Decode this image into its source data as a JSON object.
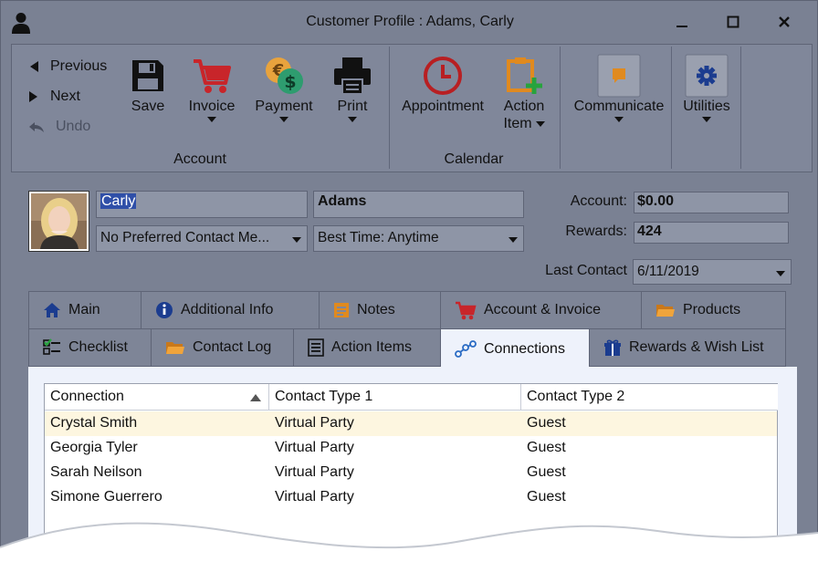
{
  "window": {
    "title": "Customer Profile : Adams, Carly"
  },
  "ribbon": {
    "nav": {
      "previous": "Previous",
      "next": "Next",
      "undo": "Undo"
    },
    "buttons": {
      "save": "Save",
      "invoice": "Invoice",
      "payment": "Payment",
      "print": "Print",
      "appointment": "Appointment",
      "action_item_1": "Action",
      "action_item_2": "Item",
      "communicate": "Communicate",
      "utilities": "Utilities"
    },
    "groups": {
      "account": "Account",
      "calendar": "Calendar"
    }
  },
  "profile": {
    "first_name": "Carly",
    "last_name": "Adams",
    "preferred_contact": "No Preferred Contact Me...",
    "best_time": "Best Time: Anytime",
    "account_label": "Account:",
    "account_value": "$0.00",
    "rewards_label": "Rewards:",
    "rewards_value": "424",
    "last_contact_label": "Last Contact",
    "last_contact_value": "6/11/2019"
  },
  "tabs": {
    "main": "Main",
    "additional_info": "Additional Info",
    "notes": "Notes",
    "account_invoice": "Account & Invoice",
    "products": "Products",
    "checklist": "Checklist",
    "contact_log": "Contact Log",
    "action_items": "Action Items",
    "connections": "Connections",
    "rewards_wish_list": "Rewards & Wish List"
  },
  "grid": {
    "columns": [
      "Connection",
      "Contact Type 1",
      "Contact Type 2"
    ],
    "rows": [
      [
        "Crystal Smith",
        "Virtual Party",
        "Guest"
      ],
      [
        "Georgia Tyler",
        "Virtual Party",
        "Guest"
      ],
      [
        "Sarah Neilson",
        "Virtual Party",
        "Guest"
      ],
      [
        "Simone Guerrero",
        "Virtual Party",
        "Guest"
      ]
    ]
  },
  "colors": {
    "window_bg": "#7a8193",
    "panel_bg": "#eef2fb",
    "selected_row": "#fdf6e0",
    "selection": "#2f4fa8"
  }
}
